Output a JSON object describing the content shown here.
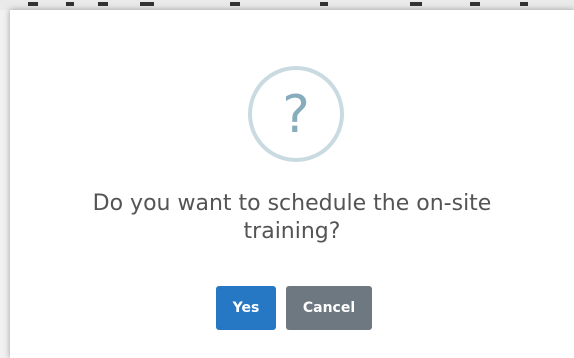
{
  "dialog": {
    "icon": "question-mark-icon",
    "icon_glyph": "?",
    "title": "Do you want to schedule the on-site training?",
    "confirm_label": "Yes",
    "cancel_label": "Cancel"
  },
  "colors": {
    "confirm_button": "#2778c4",
    "cancel_button": "#6e7881",
    "icon_ring": "#c9dae1",
    "icon_glyph": "#87adbd",
    "title_text": "#545454"
  }
}
